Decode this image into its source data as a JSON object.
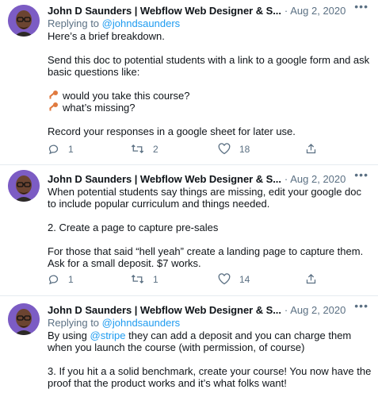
{
  "tweets": [
    {
      "author": "John D Saunders | Webflow Web Designer & S...",
      "date": "Aug 2, 2020",
      "replying_prefix": "Replying to",
      "replying_handle": "@johndsaunders",
      "lines": [
        "Here’s a brief breakdown.",
        "",
        "Send this doc to potential students with a link to a google form and ask",
        "basic questions like:",
        ""
      ],
      "bullets": [
        "would you take this course?",
        "what’s missing?"
      ],
      "lines_after": [
        "",
        "Record your responses in a google sheet for later use."
      ],
      "counts": {
        "replies": "1",
        "retweets": "2",
        "likes": "18"
      }
    },
    {
      "author": "John D Saunders | Webflow Web Designer & S...",
      "date": "Aug 2, 2020",
      "lines": [
        "When potential students say things are missing, edit your google doc",
        "to include popular curriculum and things needed.",
        "",
        "2. Create a page to capture pre-sales",
        "",
        "For those that said “hell yeah” create a landing page to capture them.",
        "Ask for a small deposit. $7 works."
      ],
      "counts": {
        "replies": "1",
        "retweets": "1",
        "likes": "14"
      }
    },
    {
      "author": "John D Saunders | Webflow Web Designer & S...",
      "date": "Aug 2, 2020",
      "replying_prefix": "Replying to",
      "replying_handle": "@johndsaunders",
      "by_using": "By using",
      "stripe_mention": "@stripe",
      "line1_rest": "they can add a deposit and you can charge them",
      "lines": [
        "when you launch the course (with permission, of course)",
        "",
        "3. If you hit a a solid benchmark, create your course! You now have the",
        "proof that the product works and it’s what folks want!"
      ]
    }
  ],
  "colors": {
    "accent": "#1d9bf0",
    "muted": "#5b7083",
    "key": "#e07a3f",
    "avatar": "#7c5cc4"
  },
  "icons": {
    "reply": "reply-icon",
    "retweet": "retweet-icon",
    "like": "heart-icon",
    "share": "share-icon",
    "more": "more-icon",
    "bullet": "key-emoji-icon"
  },
  "more_glyph": "•••",
  "separator": "·",
  "bullet_glyph": "🔑"
}
